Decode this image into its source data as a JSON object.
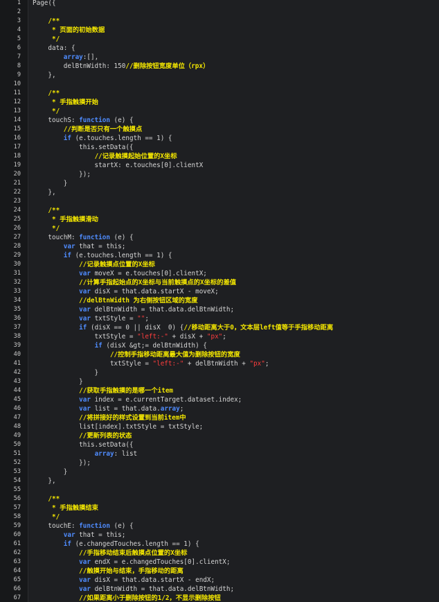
{
  "editor": {
    "lines": [
      {
        "n": "1",
        "tokens": [
          [
            "plain",
            "Page({"
          ]
        ]
      },
      {
        "n": "2",
        "tokens": []
      },
      {
        "n": "3",
        "tokens": [
          [
            "plain",
            "    "
          ],
          [
            "cm",
            "/**"
          ]
        ]
      },
      {
        "n": "4",
        "tokens": [
          [
            "plain",
            "     "
          ],
          [
            "cm",
            "* 页面的初始数据"
          ]
        ]
      },
      {
        "n": "5",
        "tokens": [
          [
            "plain",
            "     "
          ],
          [
            "cm",
            "*/"
          ]
        ]
      },
      {
        "n": "6",
        "tokens": [
          [
            "plain",
            "    data: {"
          ]
        ]
      },
      {
        "n": "7",
        "tokens": [
          [
            "plain",
            "        "
          ],
          [
            "arr",
            "array"
          ],
          [
            "plain",
            ":[],"
          ]
        ]
      },
      {
        "n": "8",
        "tokens": [
          [
            "plain",
            "        delBtnWidth: 150"
          ],
          [
            "cm",
            "//删除按钮宽度单位（rpx）"
          ]
        ]
      },
      {
        "n": "9",
        "tokens": [
          [
            "plain",
            "    },"
          ]
        ]
      },
      {
        "n": "10",
        "tokens": []
      },
      {
        "n": "11",
        "tokens": [
          [
            "plain",
            "    "
          ],
          [
            "cm",
            "/**"
          ]
        ]
      },
      {
        "n": "12",
        "tokens": [
          [
            "plain",
            "     "
          ],
          [
            "cm",
            "* 手指触摸开始"
          ]
        ]
      },
      {
        "n": "13",
        "tokens": [
          [
            "plain",
            "     "
          ],
          [
            "cm",
            "*/"
          ]
        ]
      },
      {
        "n": "14",
        "tokens": [
          [
            "plain",
            "    touchS: "
          ],
          [
            "kw",
            "function"
          ],
          [
            "plain",
            " (e) {"
          ]
        ]
      },
      {
        "n": "15",
        "tokens": [
          [
            "plain",
            "        "
          ],
          [
            "cm",
            "//判断是否只有一个触摸点"
          ]
        ]
      },
      {
        "n": "16",
        "tokens": [
          [
            "plain",
            "        "
          ],
          [
            "kw",
            "if"
          ],
          [
            "plain",
            " (e.touches.length == 1) {"
          ]
        ]
      },
      {
        "n": "17",
        "tokens": [
          [
            "plain",
            "            this.setData({"
          ]
        ]
      },
      {
        "n": "18",
        "tokens": [
          [
            "plain",
            "                "
          ],
          [
            "cm",
            "//记录触摸起始位置的X坐标"
          ]
        ]
      },
      {
        "n": "19",
        "tokens": [
          [
            "plain",
            "                startX: e.touches[0].clientX"
          ]
        ]
      },
      {
        "n": "20",
        "tokens": [
          [
            "plain",
            "            });"
          ]
        ]
      },
      {
        "n": "21",
        "tokens": [
          [
            "plain",
            "        }"
          ]
        ]
      },
      {
        "n": "22",
        "tokens": [
          [
            "plain",
            "    },"
          ]
        ]
      },
      {
        "n": "23",
        "tokens": []
      },
      {
        "n": "24",
        "tokens": [
          [
            "plain",
            "    "
          ],
          [
            "cm",
            "/**"
          ]
        ]
      },
      {
        "n": "25",
        "tokens": [
          [
            "plain",
            "     "
          ],
          [
            "cm",
            "* 手指触摸滑动"
          ]
        ]
      },
      {
        "n": "26",
        "tokens": [
          [
            "plain",
            "     "
          ],
          [
            "cm",
            "*/"
          ]
        ]
      },
      {
        "n": "27",
        "tokens": [
          [
            "plain",
            "    touchM: "
          ],
          [
            "kw",
            "function"
          ],
          [
            "plain",
            " (e) {"
          ]
        ]
      },
      {
        "n": "28",
        "tokens": [
          [
            "plain",
            "        "
          ],
          [
            "kw",
            "var"
          ],
          [
            "plain",
            " that = this;"
          ]
        ]
      },
      {
        "n": "29",
        "tokens": [
          [
            "plain",
            "        "
          ],
          [
            "kw",
            "if"
          ],
          [
            "plain",
            " (e.touches.length == 1) {"
          ]
        ]
      },
      {
        "n": "30",
        "tokens": [
          [
            "plain",
            "            "
          ],
          [
            "cm",
            "//记录触摸点位置的X坐标"
          ]
        ]
      },
      {
        "n": "31",
        "tokens": [
          [
            "plain",
            "            "
          ],
          [
            "kw",
            "var"
          ],
          [
            "plain",
            " moveX = e.touches[0].clientX;"
          ]
        ]
      },
      {
        "n": "32",
        "tokens": [
          [
            "plain",
            "            "
          ],
          [
            "cm",
            "//计算手指起始点的X坐标与当前触摸点的X坐标的差值"
          ]
        ]
      },
      {
        "n": "33",
        "tokens": [
          [
            "plain",
            "            "
          ],
          [
            "kw",
            "var"
          ],
          [
            "plain",
            " disX = that.data.startX - moveX;"
          ]
        ]
      },
      {
        "n": "34",
        "tokens": [
          [
            "plain",
            "            "
          ],
          [
            "cm",
            "//delBtnWidth 为右侧按钮区域的宽度"
          ]
        ]
      },
      {
        "n": "35",
        "tokens": [
          [
            "plain",
            "            "
          ],
          [
            "kw",
            "var"
          ],
          [
            "plain",
            " delBtnWidth = that.data.delBtnWidth;"
          ]
        ]
      },
      {
        "n": "36",
        "tokens": [
          [
            "plain",
            "            "
          ],
          [
            "kw",
            "var"
          ],
          [
            "plain",
            " txtStyle = "
          ],
          [
            "str",
            "\"\""
          ],
          [
            "plain",
            ";"
          ]
        ]
      },
      {
        "n": "37",
        "tokens": [
          [
            "plain",
            "            "
          ],
          [
            "kw",
            "if"
          ],
          [
            "plain",
            " (disX == 0 || disX  0) {"
          ],
          [
            "cm",
            "//移动距离大于0，文本层left值等于手指移动距离"
          ]
        ]
      },
      {
        "n": "38",
        "tokens": [
          [
            "plain",
            "                txtStyle = "
          ],
          [
            "str",
            "\"left:-\""
          ],
          [
            "plain",
            " + disX + "
          ],
          [
            "str",
            "\"px\""
          ],
          [
            "plain",
            ";"
          ]
        ]
      },
      {
        "n": "39",
        "tokens": [
          [
            "plain",
            "                "
          ],
          [
            "kw",
            "if"
          ],
          [
            "plain",
            " (disX &gt;= delBtnWidth) {"
          ]
        ]
      },
      {
        "n": "40",
        "tokens": [
          [
            "plain",
            "                    "
          ],
          [
            "cm",
            "//控制手指移动距离最大值为删除按钮的宽度"
          ]
        ]
      },
      {
        "n": "41",
        "tokens": [
          [
            "plain",
            "                    txtStyle = "
          ],
          [
            "str",
            "\"left:-\""
          ],
          [
            "plain",
            " + delBtnWidth + "
          ],
          [
            "str",
            "\"px\""
          ],
          [
            "plain",
            ";"
          ]
        ]
      },
      {
        "n": "42",
        "tokens": [
          [
            "plain",
            "                }"
          ]
        ]
      },
      {
        "n": "43",
        "tokens": [
          [
            "plain",
            "            }"
          ]
        ]
      },
      {
        "n": "44",
        "tokens": [
          [
            "plain",
            "            "
          ],
          [
            "cm",
            "//获取手指触摸的是哪一个item"
          ]
        ]
      },
      {
        "n": "45",
        "tokens": [
          [
            "plain",
            "            "
          ],
          [
            "kw",
            "var"
          ],
          [
            "plain",
            " index = e.currentTarget.dataset.index;"
          ]
        ]
      },
      {
        "n": "46",
        "tokens": [
          [
            "plain",
            "            "
          ],
          [
            "kw",
            "var"
          ],
          [
            "plain",
            " list = that.data."
          ],
          [
            "arr",
            "array"
          ],
          [
            "plain",
            ";"
          ]
        ]
      },
      {
        "n": "47",
        "tokens": [
          [
            "plain",
            "            "
          ],
          [
            "cm",
            "//将拼接好的样式设置到当前item中"
          ]
        ]
      },
      {
        "n": "48",
        "tokens": [
          [
            "plain",
            "            list[index].txtStyle = txtStyle;"
          ]
        ]
      },
      {
        "n": "49",
        "tokens": [
          [
            "plain",
            "            "
          ],
          [
            "cm",
            "//更新列表的状态"
          ]
        ]
      },
      {
        "n": "50",
        "tokens": [
          [
            "plain",
            "            this.setData({"
          ]
        ]
      },
      {
        "n": "51",
        "tokens": [
          [
            "plain",
            "                "
          ],
          [
            "arr",
            "array"
          ],
          [
            "plain",
            ": list"
          ]
        ]
      },
      {
        "n": "52",
        "tokens": [
          [
            "plain",
            "            });"
          ]
        ]
      },
      {
        "n": "53",
        "tokens": [
          [
            "plain",
            "        }"
          ]
        ]
      },
      {
        "n": "54",
        "tokens": [
          [
            "plain",
            "    },"
          ]
        ]
      },
      {
        "n": "55",
        "tokens": []
      },
      {
        "n": "56",
        "tokens": [
          [
            "plain",
            "    "
          ],
          [
            "cm",
            "/**"
          ]
        ]
      },
      {
        "n": "57",
        "tokens": [
          [
            "plain",
            "     "
          ],
          [
            "cm",
            "* 手指触摸结束"
          ]
        ]
      },
      {
        "n": "58",
        "tokens": [
          [
            "plain",
            "     "
          ],
          [
            "cm",
            "*/"
          ]
        ]
      },
      {
        "n": "59",
        "tokens": [
          [
            "plain",
            "    touchE: "
          ],
          [
            "kw",
            "function"
          ],
          [
            "plain",
            " (e) {"
          ]
        ]
      },
      {
        "n": "60",
        "tokens": [
          [
            "plain",
            "        "
          ],
          [
            "kw",
            "var"
          ],
          [
            "plain",
            " that = this;"
          ]
        ]
      },
      {
        "n": "61",
        "tokens": [
          [
            "plain",
            "        "
          ],
          [
            "kw",
            "if"
          ],
          [
            "plain",
            " (e.changedTouches.length == 1) {"
          ]
        ]
      },
      {
        "n": "62",
        "tokens": [
          [
            "plain",
            "            "
          ],
          [
            "cm",
            "//手指移动结束后触摸点位置的X坐标"
          ]
        ]
      },
      {
        "n": "63",
        "tokens": [
          [
            "plain",
            "            "
          ],
          [
            "kw",
            "var"
          ],
          [
            "plain",
            " endX = e.changedTouches[0].clientX;"
          ]
        ]
      },
      {
        "n": "64",
        "tokens": [
          [
            "plain",
            "            "
          ],
          [
            "cm",
            "//触摸开始与结束，手指移动的距离"
          ]
        ]
      },
      {
        "n": "65",
        "tokens": [
          [
            "plain",
            "            "
          ],
          [
            "kw",
            "var"
          ],
          [
            "plain",
            " disX = that.data.startX - endX;"
          ]
        ]
      },
      {
        "n": "66",
        "tokens": [
          [
            "plain",
            "            "
          ],
          [
            "kw",
            "var"
          ],
          [
            "plain",
            " delBtnWidth = that.data.delBtnWidth;"
          ]
        ]
      },
      {
        "n": "67",
        "tokens": [
          [
            "plain",
            "            "
          ],
          [
            "cm",
            "//如果距离小于删除按钮的1/2，不显示删除按钮"
          ]
        ]
      }
    ]
  }
}
